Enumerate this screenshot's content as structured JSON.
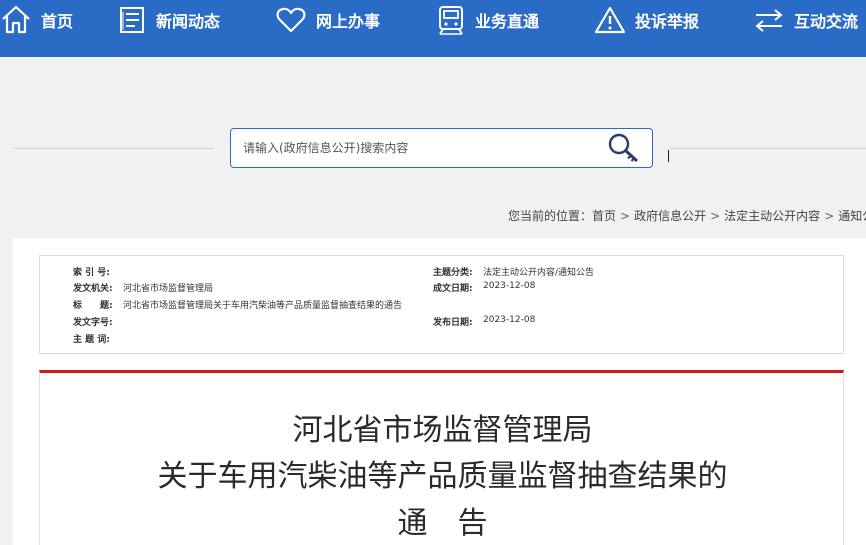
{
  "nav": {
    "home": "首页",
    "news": "新闻动态",
    "online": "网上办事",
    "business": "业务直通",
    "complaint": "投诉举报",
    "interaction": "互动交流"
  },
  "search": {
    "placeholder": "请输入(政府信息公开)搜索内容"
  },
  "breadcrumb": {
    "prefix": "您当前的位置：",
    "items": [
      "首页",
      "政府信息公开",
      "法定主动公开内容",
      "通知公告"
    ],
    "sep": ">"
  },
  "meta": {
    "index_label": "索 引 号:",
    "index_value": "",
    "issuer_label": "发文机关:",
    "issuer_value": "河北省市场监督管理局",
    "title_label": "标　　题:",
    "title_value": "河北省市场监督管理局关于车用汽柴油等产品质量监督抽查结果的通告",
    "docno_label": "发文字号:",
    "docno_value": "",
    "keywords_label": "主 题 词:",
    "keywords_value": "",
    "category_label": "主题分类:",
    "category_value": "法定主动公开内容/通知公告",
    "written_label": "成文日期:",
    "written_value": "2023-12-08",
    "published_label": "发布日期:",
    "published_value": "2023-12-08"
  },
  "article": {
    "title_line1": "河北省市场监督管理局",
    "title_line2": "关于车用汽柴油等产品质量监督抽查结果的",
    "title_line3": "通　告"
  },
  "colors": {
    "nav_bg": "#2a6bc5",
    "accent_red": "#cf1b1b",
    "page_bg": "#f1f1f1"
  },
  "icons": {
    "home": "home-icon",
    "news": "document-list-icon",
    "online": "heart-icon",
    "business": "train-icon",
    "complaint": "warning-icon",
    "interaction": "exchange-arrows-icon",
    "search": "magnifier-key-icon"
  }
}
